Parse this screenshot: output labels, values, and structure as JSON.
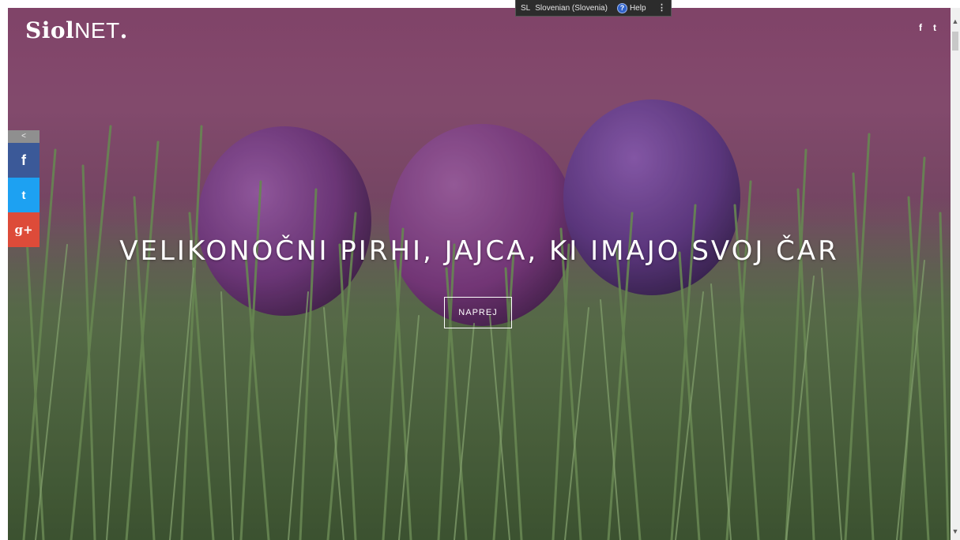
{
  "logo": {
    "bold": "Siol",
    "normal": "NET",
    "dot": "."
  },
  "language_bar": {
    "language_code": "SL",
    "language_name": "Slovenian (Slovenia)",
    "help_label": "Help",
    "help_icon": "question-circle-icon"
  },
  "header_social": {
    "facebook": "f",
    "twitter": "t"
  },
  "share_sidebar": {
    "toggle": "<",
    "facebook": "f",
    "twitter": "t",
    "google_plus": "g+"
  },
  "hero": {
    "headline": "VELIKONOČNI PIRHI, JAJCA, KI IMAJO SVOJ ČAR",
    "button_label": "NAPREJ"
  },
  "colors": {
    "facebook": "#3b5998",
    "twitter": "#1da1f2",
    "google_plus": "#dd4b39",
    "egg": "#7c3c8e",
    "grass": "#4d6b39"
  }
}
